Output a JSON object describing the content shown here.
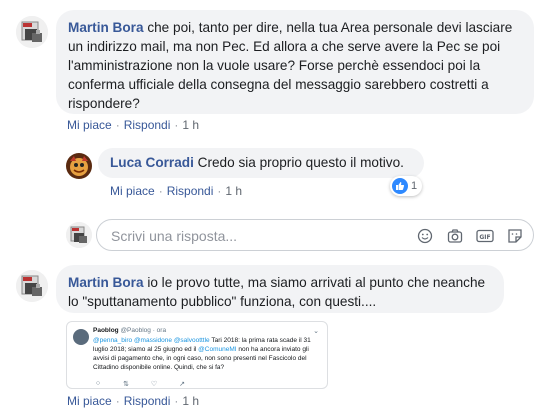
{
  "comments": [
    {
      "author": "Martin Bora",
      "text": "che poi, tanto per dire, nella tua Area personale devi lasciare un indirizzo mail, ma non Pec. Ed allora a che serve avere la Pec se poi l'amministrazione non la vuole usare? Forse perchè essendoci poi la conferma ufficiale della consegna del messaggio sarebbero costretti a rispondere?",
      "like_label": "Mi piace",
      "reply_label": "Rispondi",
      "time": "1 h"
    },
    {
      "author": "Luca Corradi",
      "text": "Credo sia proprio questo il motivo.",
      "like_label": "Mi piace",
      "reply_label": "Rispondi",
      "time": "1 h",
      "reaction_count": "1"
    },
    {
      "author": "Martin Bora",
      "text": "io le provo tutte, ma siamo arrivati al punto che neanche lo \"sputtanamento pubblico\" funziona, con questi....",
      "like_label": "Mi piace",
      "reply_label": "Rispondi",
      "time": "1 h"
    }
  ],
  "reply_box": {
    "placeholder": "Scrivi una risposta...",
    "icons": [
      "emoji-icon",
      "camera-icon",
      "gif-icon",
      "sticker-icon"
    ]
  },
  "embed": {
    "name": "Paoblog",
    "handle": "@Paoblog · ora",
    "mention1": "@penna_biro",
    "mention2": "@massidone",
    "mention3": "@salvootttle",
    "text1": "Tari 2018: la prima rata scade il 31 luglio 2018; siamo al 25 giugno ed il",
    "mention4": "@ComuneMI",
    "text2": "non ha ancora inviato gli avvisi di pagamento che, in ogni caso, non sono presenti nel Fascicolo del Cittadino disponibile online. Quindi, che si fa?"
  },
  "colors": {
    "link": "#385898",
    "bubble": "#f2f3f5",
    "like_blue": "#2e89ff"
  }
}
